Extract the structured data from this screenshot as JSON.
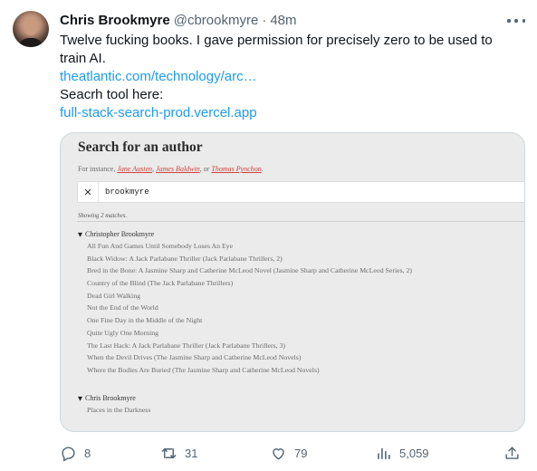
{
  "tweet": {
    "display_name": "Chris Brookmyre",
    "handle": "@cbrookmyre",
    "separator": "·",
    "time": "48m",
    "text_line1": "Twelve fucking books. I gave permission for precisely zero to be used to",
    "text_line2": "train AI.",
    "link1": "theatlantic.com/technology/arc…",
    "text_line3": "Seacrh tool here:",
    "link2": "full-stack-search-prod.vercel.app"
  },
  "media": {
    "title": "Search for an author",
    "hint_prefix": "For instance,",
    "hint_authors": [
      "Jane Austen",
      "James Baldwin"
    ],
    "hint_or": ", or",
    "hint_last_author": "Thomas Pynchon",
    "hint_suffix": ".",
    "clear_label": "✕",
    "search_value": "brookmyre",
    "matches_text": "Showing 2 matches.",
    "groups": [
      {
        "author": "Christopher Brookmyre",
        "books": [
          "All Fun And Games Until Somebody Loses An Eye",
          "Black Widow: A Jack Parlabane Thriller (Jack Parlabane Thrillers, 2)",
          "Bred in the Bone: A Jasmine Sharp and Catherine McLeod Novel (Jasmine Sharp and Catherine McLeod Series, 2)",
          "Country of the Blind (The Jack Parlabane Thrillers)",
          "Dead Girl Walking",
          "Not the End of the World",
          "One Fine Day in the Middle of the Night",
          "Quite Ugly One Morning",
          "The Last Hack: A Jack Parlabane Thriller (Jack Parlabane Thrillers, 3)",
          "When the Devil Drives (The Jasmine Sharp and Catherine McLeod Novels)",
          "Where the Bodies Are Buried (The Jasmine Sharp and Catherine McLeod Novels)"
        ]
      },
      {
        "author": "Chris Brookmyre",
        "books": [
          "Places in the Darkness"
        ]
      }
    ],
    "toggle_glyph": "▼"
  },
  "actions": {
    "replies": "8",
    "reposts": "31",
    "likes": "79",
    "views": "5,059"
  },
  "icons": [
    "more-icon",
    "reply-icon",
    "repost-icon",
    "like-icon",
    "views-icon",
    "share-icon",
    "close-icon",
    "disclosure-triangle-icon"
  ],
  "colors": {
    "link": "#1d9bf0",
    "secondary_text": "#536471",
    "author_link": "#d0413b"
  }
}
